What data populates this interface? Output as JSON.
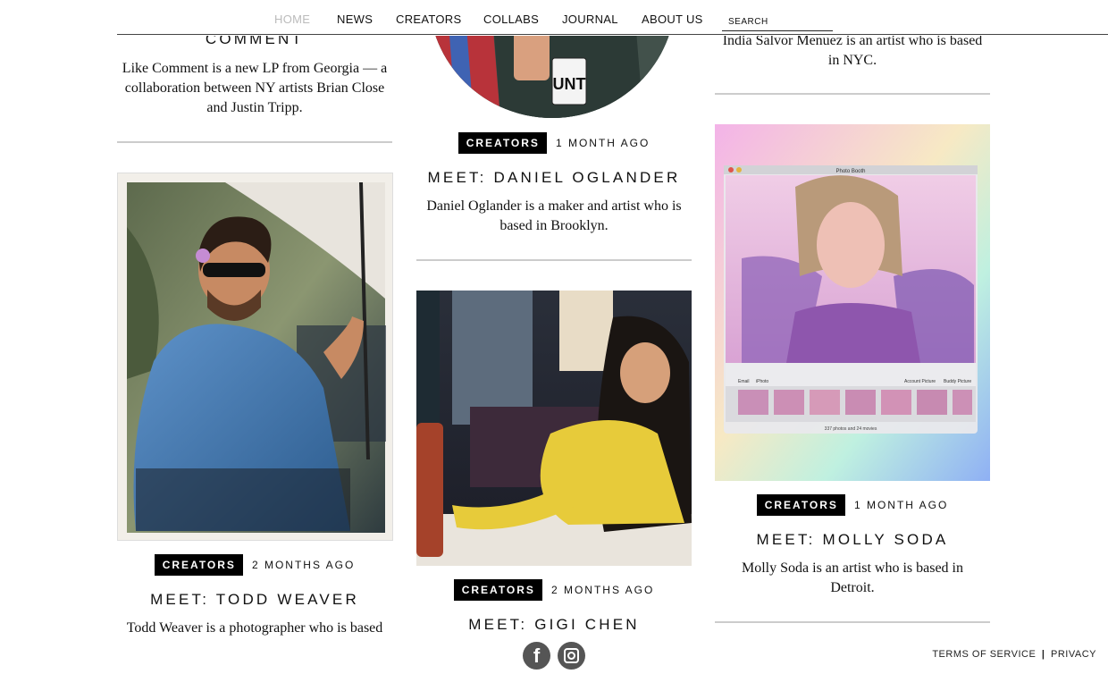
{
  "nav": {
    "items": [
      "HOME",
      "NEWS",
      "CREATORS",
      "COLLABS",
      "JOURNAL",
      "ABOUT US"
    ],
    "search_placeholder": "SEARCH"
  },
  "col1": {
    "top_title": "COMMENT",
    "top_desc": "Like Comment is a new LP from Georgia — a collaboration between NY artists Brian Close and Justin Tripp.",
    "card": {
      "category": "CREATORS",
      "time": "2 MONTHS AGO",
      "title": "MEET: TODD WEAVER",
      "desc": "Todd Weaver is a photographer who is based"
    }
  },
  "col2": {
    "mug_text": "UNT",
    "card1": {
      "category": "CREATORS",
      "time": "1 MONTH AGO",
      "title": "MEET: DANIEL OGLANDER",
      "desc": "Daniel Oglander is a maker and artist who is based in Brooklyn."
    },
    "card2": {
      "category": "CREATORS",
      "time": "2 MONTHS AGO",
      "title": "MEET: GIGI CHEN"
    }
  },
  "col3": {
    "top_desc": "India Salvor Menuez is an artist who is based in NYC.",
    "card": {
      "category": "CREATORS",
      "time": "1 MONTH AGO",
      "title": "MEET: MOLLY SODA",
      "desc": "Molly Soda is an artist who is based in Detroit."
    },
    "photobooth": {
      "window_title": "Photo Booth",
      "tools": [
        "Email",
        "iPhoto",
        "Account Picture",
        "Buddy Picture"
      ],
      "status": "337 photos and 24 movies"
    }
  },
  "social": {
    "facebook": "f"
  },
  "footer": {
    "terms": "TERMS OF SERVICE",
    "separator": "|",
    "privacy": "PRIVACY"
  },
  "colors": {
    "badge": "#000000",
    "divider": "#cccccc",
    "nav_active": "#bbbbbb"
  }
}
